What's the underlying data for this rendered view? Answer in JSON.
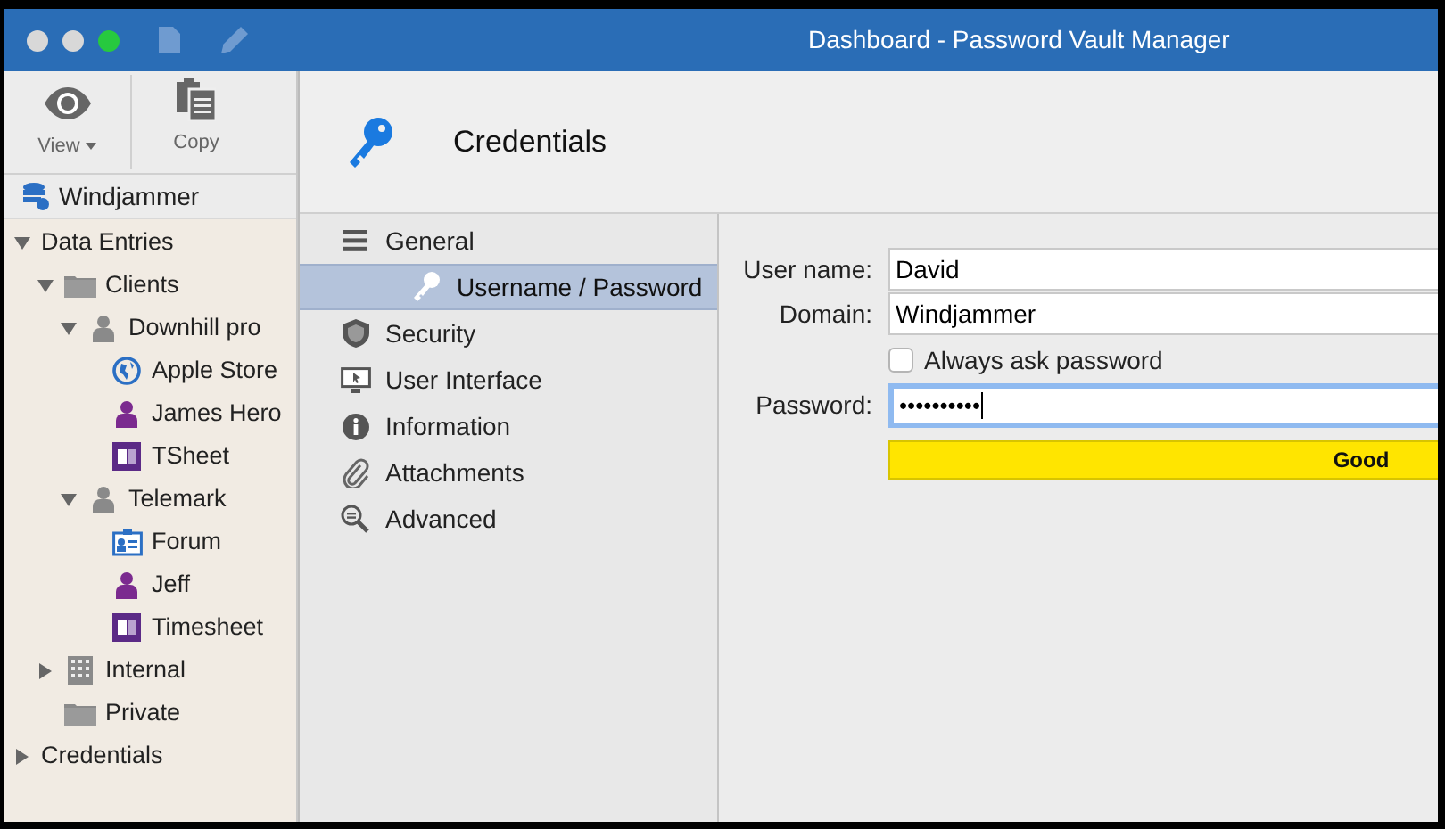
{
  "window": {
    "title": "Dashboard - Password Vault Manager"
  },
  "toolbar": [
    {
      "label": "View",
      "kind": "eye",
      "dropdown": true
    },
    {
      "label": "Copy",
      "kind": "copy",
      "dropdown": false
    }
  ],
  "vault": {
    "name": "Windjammer"
  },
  "tree": [
    {
      "label": "Data Entries",
      "expanded": true,
      "children": [
        {
          "label": "Clients",
          "kind": "folder",
          "expanded": true,
          "children": [
            {
              "label": "Downhill pro",
              "kind": "user",
              "expanded": true,
              "children": [
                {
                  "label": "Apple Store",
                  "kind": "globe"
                },
                {
                  "label": "James Hero",
                  "kind": "person"
                },
                {
                  "label": "TSheet",
                  "kind": "sheet"
                }
              ]
            },
            {
              "label": "Telemark",
              "kind": "user",
              "expanded": true,
              "children": [
                {
                  "label": "Forum",
                  "kind": "card"
                },
                {
                  "label": "Jeff",
                  "kind": "person"
                },
                {
                  "label": "Timesheet",
                  "kind": "sheet"
                }
              ]
            }
          ]
        },
        {
          "label": "Internal",
          "kind": "building",
          "expanded": false
        },
        {
          "label": "Private",
          "kind": "folder"
        }
      ]
    },
    {
      "label": "Credentials",
      "expanded": false
    }
  ],
  "header": {
    "title": "Credentials"
  },
  "sections": [
    {
      "label": "General",
      "kind": "lines",
      "sub": false,
      "selected": false
    },
    {
      "label": "Username / Password",
      "kind": "key",
      "sub": true,
      "selected": true
    },
    {
      "label": "Security",
      "kind": "shield",
      "sub": false,
      "selected": false
    },
    {
      "label": "User Interface",
      "kind": "monitor",
      "sub": false,
      "selected": false
    },
    {
      "label": "Information",
      "kind": "info",
      "sub": false,
      "selected": false
    },
    {
      "label": "Attachments",
      "kind": "clip",
      "sub": false,
      "selected": false
    },
    {
      "label": "Advanced",
      "kind": "magnifier",
      "sub": false,
      "selected": false
    }
  ],
  "form": {
    "user_name": {
      "label": "User name:",
      "value": "David"
    },
    "domain": {
      "label": "Domain:",
      "value": "Windjammer"
    },
    "always_ask": {
      "label": "Always ask password",
      "checked": false
    },
    "password": {
      "label": "Password:",
      "value": "••••••••••",
      "focused": true
    },
    "strength": {
      "label": "Good",
      "color": "#ffe500"
    }
  }
}
